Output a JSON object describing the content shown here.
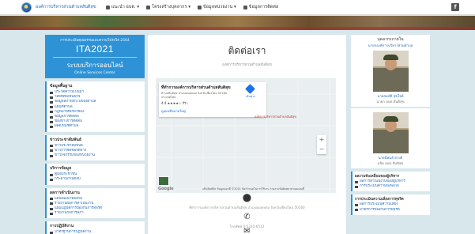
{
  "header": {
    "brand": "องค์การบริหารส่วนตำบลสันติสุข",
    "menu": [
      {
        "label": "แนะนำ อบต. ▾",
        "icon": "home-icon"
      },
      {
        "label": "โครงสร้างบุคลากร ▾",
        "icon": "org-icon"
      },
      {
        "label": "ข้อมูลหน่วยงาน ▾",
        "icon": "info-icon"
      },
      {
        "label": "ข้อมูลการติดต่อ",
        "icon": "contact-icon"
      }
    ],
    "facebook_icon": "facebook-icon",
    "facebook_glyph": "f"
  },
  "left": {
    "ita": {
      "sub": "การประเมินคุณธรรมและความโปร่งใส 2564",
      "title": "ITA2021",
      "online": "ระบบบริการออนไลน์",
      "online_en": "Online Services Center"
    },
    "sections": [
      {
        "title": "ข้อมูลพื้นฐาน",
        "items": [
          "ประวัติความเป็นมา",
          "วิสัยทัศน์/พันธกิจ",
          "ข้อมูลสภาพทั่วไปของตำบล",
          "แผนที่ตำบล",
          "กฎหมายที่เกี่ยวข้อง",
          "ข้อมูลการติดต่อ",
          "ช่องทางการติดต่อ",
          "ผลิตภัณฑ์ตำบล"
        ]
      },
      {
        "title": "ข่าวประชาสัมพันธ์",
        "items": [
          "ข่าวประชาสัมพันธ์",
          "ข่าวการจัดซื้อจัดจ้าง",
          "ข่าวกิจกรรมของหน่วยงาน"
        ]
      },
      {
        "title": "บริการข้อมูล",
        "items": [
          "คู่มือประชาชน",
          "กระดานถามตอบ"
        ]
      },
      {
        "title": "ผลการดำเนินงาน",
        "items": [
          "แผนพัฒนาท้องถิ่น",
          "รายงานผลการดำเนินงาน",
          "แผนปฏิบัติการป้องกันการทุจริต",
          "รายงานกิจการสภา"
        ]
      },
      {
        "title": "การปฏิบัติงาน",
        "items": [
          "มาตรฐานการปฏิบัติงาน"
        ]
      }
    ]
  },
  "main": {
    "title": "ติดต่อเรา",
    "subtitle": "องค์การบริหารส่วนตำบลสันติสุข",
    "map": {
      "place_name": "ที่ทำการองค์การบริหารส่วนตำบลสันติสุข",
      "address": "ตำบลสันติสุข อำเภอดอยหล่อ จังหวัดเชียงใหม่ 50160 ประเทศไทย",
      "rating": "4.4 ★★★★☆ รีวิว",
      "larger_map": "ดูแผนที่ขนาดใหญ่",
      "directions": "เส้นทาง",
      "pin_label": "องค์การบริหารส่วนตำบลสันติสุข",
      "zoom_in": "+",
      "zoom_out": "−",
      "google": "Google",
      "footer": "แป้นพิมพ์ลัด  ข้อมูลแผนที่ ©2021  ข้อกำหนดในการใช้งาน  รายงานข้อผิดพลาดของแผนที่"
    },
    "contacts": [
      {
        "icon": "location-icon",
        "glyph": "⬤",
        "text": "ที่ทำการองค์การบริหารส่วนตำบลสันติสุข อำเภอดอยหล่อ จังหวัดเชียงใหม่ 50160"
      },
      {
        "icon": "phone-icon",
        "glyph": "✆",
        "text": "โทรศัพท์ 0-5310-6512"
      },
      {
        "icon": "email-icon",
        "glyph": "✉",
        "text": "saraban@santisuk.go.th"
      }
    ]
  },
  "right": {
    "people": [
      {
        "heading": "บุคลากรภายใน",
        "sub": "นายกองค์การบริหารส่วนตำบล",
        "name": "นายสมบัติ สุขใจดี",
        "role": "นายก อบต.สันติสุข"
      },
      {
        "heading": "",
        "sub": "",
        "name": "นายนิพนธ์ ดวงดี",
        "role": "ปลัด อบต.สันติสุข"
      }
    ],
    "sections": [
      {
        "title": "ผลงานขับเคลื่อนของผู้บริหาร",
        "items": [
          "ผลการดำเนินงานของผู้บริหาร",
          "การประเมินความพึงพอใจ"
        ]
      },
      {
        "title": "การประเมินความเสี่ยงการทุจริต",
        "items": [
          "ผลการประเมินความเสี่ยง",
          "มาตรการป้องกันการทุจริต"
        ]
      }
    ]
  }
}
